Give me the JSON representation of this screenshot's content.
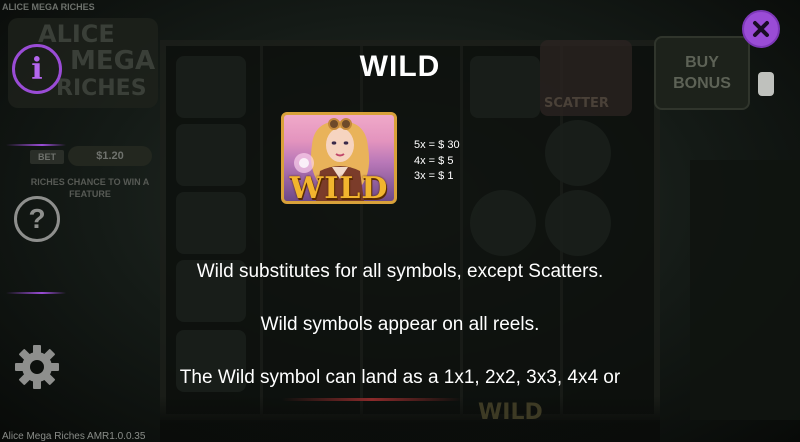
{
  "game": {
    "title_strip": "ALICE MEGA RICHES",
    "logo_text": [
      "ALICE",
      "MEGA",
      "RICHES"
    ],
    "version": "Alice Mega Riches AMR1.0.0.35"
  },
  "background": {
    "bet_label": "BET",
    "bet_value": "$1.20",
    "riches_chance": "RICHES CHANCE TO WIN A FEATURE",
    "scatter_label": "SCATTER",
    "buy_bonus": [
      "BUY",
      "BONUS"
    ],
    "wild_ghost": "WILD"
  },
  "sidebar": {
    "info_glyph": "i",
    "help_glyph": "?",
    "icons": [
      "info-icon",
      "help-icon",
      "gear-icon"
    ]
  },
  "close_icon": "close-icon",
  "panel": {
    "title": "WILD",
    "symbol_label": "WILD",
    "paytable": [
      "5x = $ 30",
      "4x = $ 5",
      "3x = $ 1"
    ],
    "descriptions": [
      "Wild substitutes for all symbols, except Scatters.",
      "Wild symbols appear on all reels.",
      "The Wild symbol can land as a 1x1, 2x2, 3x3, 4x4 or"
    ]
  },
  "colors": {
    "accent_purple": "#9a4cd6",
    "wild_gold": "#f2b52e",
    "text": "#ffffff"
  }
}
